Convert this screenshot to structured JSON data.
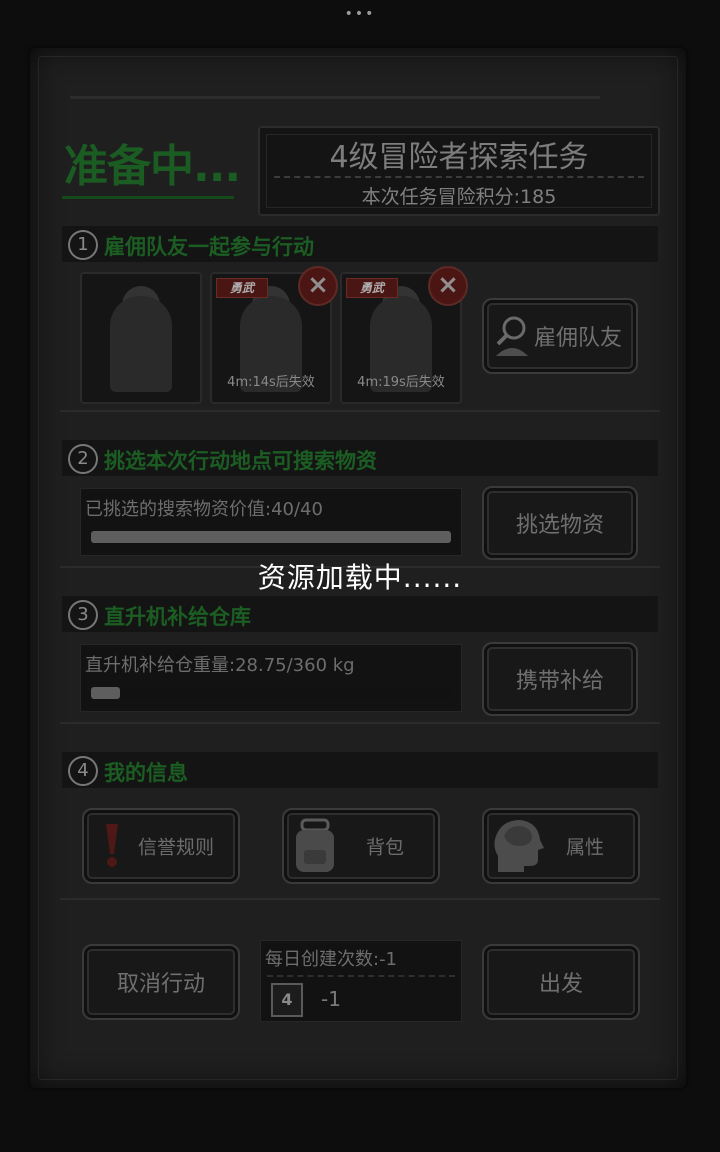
{
  "top_dots": "•••",
  "status_title": "准备中...",
  "mission": {
    "title": "4级冒险者探索任务",
    "score_text": "本次任务冒险积分:185"
  },
  "sections": [
    {
      "num": "1",
      "title": "雇佣队友一起参与行动"
    },
    {
      "num": "2",
      "title": "挑选本次行动地点可搜索物资"
    },
    {
      "num": "3",
      "title": "直升机补给仓库"
    },
    {
      "num": "4",
      "title": "我的信息"
    }
  ],
  "teammates": [
    {
      "tag": "",
      "timer": ""
    },
    {
      "tag": "勇武",
      "timer": "4m:14s后失效"
    },
    {
      "tag": "勇武",
      "timer": "4m:19s后失效"
    }
  ],
  "remove_icon": "×",
  "hire_button": "雇佣队友",
  "supplies": {
    "text": "已挑选的搜索物资价值:40/40",
    "progress": 1.0,
    "button": "挑选物资"
  },
  "warehouse": {
    "text": "直升机补给仓重量:28.75/360 kg",
    "progress": 0.08,
    "button": "携带补给"
  },
  "my_info": {
    "reputation": "信誉规则",
    "backpack": "背包",
    "attributes": "属性"
  },
  "bottom": {
    "cancel": "取消行动",
    "daily_label": "每日创建次数:-1",
    "calendar_num": "4",
    "daily_value": "-1",
    "depart": "出发"
  },
  "loading_text": "资源加载中......",
  "colors": {
    "title_green": "#1a5c22",
    "tag_red": "#4a1614"
  }
}
